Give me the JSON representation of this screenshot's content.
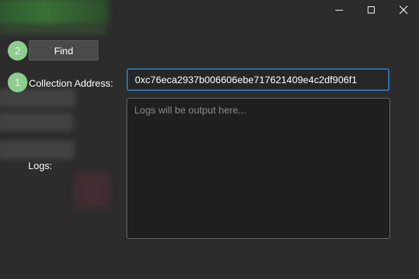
{
  "window": {
    "controls": {
      "minimize_icon": "minimize-icon",
      "maximize_icon": "maximize-icon",
      "close_icon": "close-icon",
      "close_glyph": "✕"
    }
  },
  "steps": {
    "find_step": "2",
    "address_step": "1"
  },
  "toolbar": {
    "find_label": "Find"
  },
  "form": {
    "collection_label": "Collection Address:",
    "collection_value": "0xc76eca2937b006606ebe717621409e4c2df906f1",
    "logs_label": "Logs:",
    "logs_placeholder": "Logs will be output here..."
  },
  "colors": {
    "background": "#2c2c2c",
    "accent_focus": "#2f6fb8",
    "step_badge": "#8fcc8f"
  }
}
